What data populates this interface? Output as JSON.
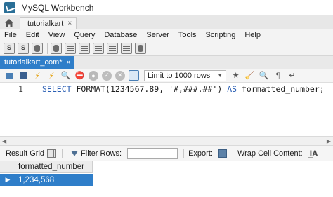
{
  "window": {
    "title": "MySQL Workbench"
  },
  "connection_tab": {
    "label": "tutorialkart",
    "close_glyph": "×"
  },
  "menu": {
    "items": [
      "File",
      "Edit",
      "View",
      "Query",
      "Database",
      "Server",
      "Tools",
      "Scripting",
      "Help"
    ]
  },
  "main_toolbar": {
    "icons": [
      "new-sql-tab-icon",
      "open-sql-script-icon",
      "inspector-icon",
      "create-schema-icon",
      "create-table-icon",
      "create-view-icon",
      "create-procedure-icon",
      "create-function-icon",
      "search-table-icon",
      "reconnect-icon"
    ]
  },
  "query_tab": {
    "label": "tutorialkart_com*",
    "close_glyph": "×"
  },
  "editor_toolbar": {
    "limit_label": "Limit to 1000 rows",
    "icons": [
      "open-script-icon",
      "save-script-icon",
      "execute-icon",
      "execute-current-icon",
      "explain-icon",
      "stop-icon",
      "toggle-continue-icon",
      "commit-icon",
      "rollback-icon",
      "autocommit-icon",
      "beautify-icon",
      "find-icon",
      "invisible-chars-icon",
      "wrap-lines-icon"
    ]
  },
  "editor": {
    "line_number": "1",
    "code": {
      "keyword_select": "SELECT",
      "func_name": "FORMAT",
      "open_paren": "(",
      "number_arg": "1234567.89",
      "comma": ", ",
      "string_arg": "'#,###.##'",
      "close_paren": ")",
      "keyword_as": "AS",
      "alias": "formatted_number;"
    }
  },
  "result_toolbar": {
    "result_grid_label": "Result Grid",
    "filter_label": "Filter Rows:",
    "filter_value": "",
    "export_label": "Export:",
    "wrap_label": "Wrap Cell Content:"
  },
  "result_grid": {
    "columns": [
      "formatted_number"
    ],
    "rows": [
      [
        "1,234,568"
      ]
    ],
    "row_marker": "▶"
  },
  "colors": {
    "selection_blue": "#2f7ec9",
    "keyword_blue": "#2b5fb4"
  }
}
